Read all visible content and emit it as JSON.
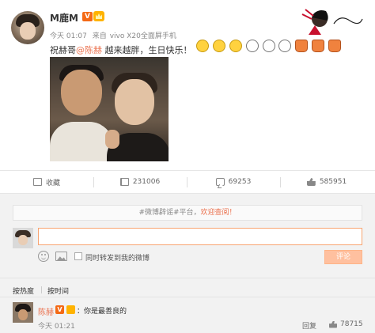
{
  "post": {
    "username": "M鹿M",
    "verified_badge": "V",
    "meta": {
      "time": "今天 01:07",
      "source_prefix": "来自",
      "source": "vivo X20全面屏手机"
    },
    "text_before": "祝赫哥",
    "mention": "@陈赫",
    "text_after": " 越来越胖，生日快乐！",
    "emojis": [
      "smile",
      "smile",
      "smile",
      "face",
      "face",
      "face",
      "cake",
      "cake",
      "cake"
    ]
  },
  "actions": {
    "favorite_label": "收藏",
    "repost_count": "231006",
    "comment_count": "69253",
    "like_count": "585951"
  },
  "comment_box": {
    "notice_prefix": "#微博辟谣#平台，",
    "notice_highlight": "欢迎查阅！",
    "input_value": "",
    "repost_label": "同时转发到我的微博",
    "submit_label": "评论"
  },
  "sort": {
    "hot": "按热度",
    "time": "按时间"
  },
  "comments": [
    {
      "user": "陈赫",
      "badge": "V",
      "text": "：你是最善良的",
      "time": "今天 01:21",
      "reply_label": "回复",
      "likes": "78715"
    }
  ],
  "colors": {
    "accent": "#eb7350",
    "badge": "#f46a16",
    "submit": "#ffc09f"
  }
}
